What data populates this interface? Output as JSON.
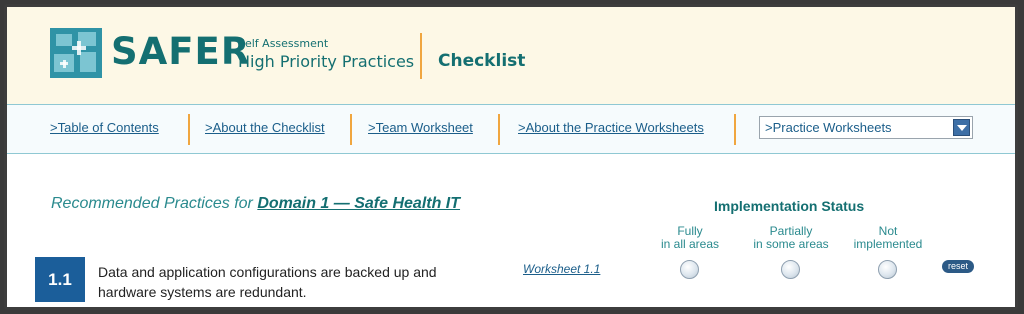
{
  "header": {
    "brand": "SAFER",
    "subtitle_small": "Self Assessment",
    "subtitle_large": "High Priority Practices",
    "section_title": "Checklist"
  },
  "nav": {
    "links": [
      ">Table of Contents",
      ">About the Checklist",
      ">Team Worksheet",
      ">About the Practice Worksheets"
    ],
    "select_value": ">Practice Worksheets"
  },
  "main": {
    "heading_prefix": "Recommended Practices for ",
    "heading_domain": "Domain 1 — Safe Health IT",
    "implementation_title": "Implementation Status",
    "status_columns": [
      {
        "line1": "Fully",
        "line2": "in all areas"
      },
      {
        "line1": "Partially",
        "line2": "in some areas"
      },
      {
        "line1": "Not",
        "line2": "implemented"
      }
    ],
    "practice": {
      "number": "1.1",
      "text": "Data and application configurations are backed up and hardware systems are redundant.",
      "worksheet_link": "Worksheet 1.1",
      "reset_label": "reset"
    }
  },
  "colors": {
    "brand_teal": "#146f71",
    "accent_orange": "#f0a640",
    "header_bg": "#fdf8e6",
    "number_badge": "#1b5e9a"
  }
}
